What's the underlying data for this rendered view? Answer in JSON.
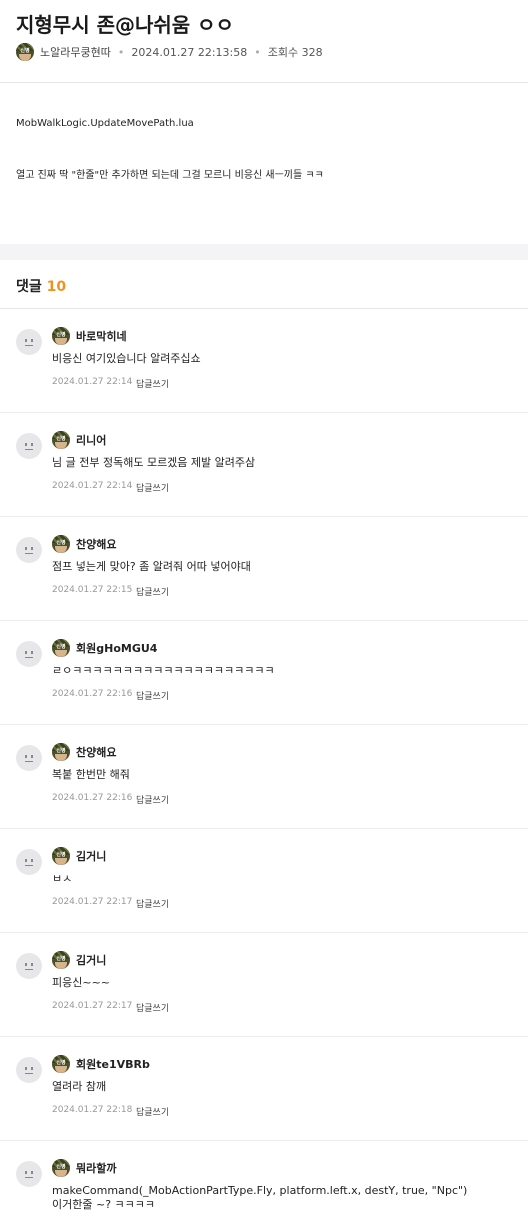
{
  "post": {
    "title": "지형무시 존@나쉬움 ㅇㅇ",
    "badge_label": "신병",
    "author": "노알라무쿵현따",
    "date": "2024.01.27 22:13:58",
    "views": "조회수 328",
    "body_line1": "MobWalkLogic.UpdateMovePath.lua",
    "body_line2": "열고 진짜 딱 \"한줄\"만 추가하면 되는데 그걸 모르니 비응신 새ㅡ끼들 ㅋㅋ"
  },
  "comments_section": {
    "label": "댓글",
    "count": "10",
    "reply_label": "답글쓰기"
  },
  "comments": [
    {
      "nick": "바로막히네",
      "text": "비응신 여기있습니다 알려주십쇼",
      "date": "2024.01.27 22:14"
    },
    {
      "nick": "리니어",
      "text": "님 글 전부 정독해도 모르겠음 제발 알려주삼",
      "date": "2024.01.27 22:14"
    },
    {
      "nick": "찬양해요",
      "text": "점프 넣는게 맞아? 좀 알려줘 어따 넣어야대",
      "date": "2024.01.27 22:15"
    },
    {
      "nick": "회원gHoMGU4",
      "text": "ㄹㅇㅋㅋㅋㅋㅋㅋㅋㅋㅋㅋㅋㅋㅋㅋㅋㅋㅋㅋㅋㅋ",
      "date": "2024.01.27 22:16"
    },
    {
      "nick": "찬양해요",
      "text": "복붙 한번만 해줘",
      "date": "2024.01.27 22:16"
    },
    {
      "nick": "김거니",
      "text": "ㅂㅅ",
      "date": "2024.01.27 22:17"
    },
    {
      "nick": "김거니",
      "text": "피응신~~~",
      "date": "2024.01.27 22:17"
    },
    {
      "nick": "회원te1VBRb",
      "text": "열려라 참깨",
      "date": "2024.01.27 22:18"
    },
    {
      "nick": "뭐라할까",
      "text": "makeCommand(_MobActionPartType.Fly, platform.left.x, destY, true, \"Npc\")",
      "text2": "이거한줄 ~? ㅋㅋㅋㅋ"
    }
  ]
}
